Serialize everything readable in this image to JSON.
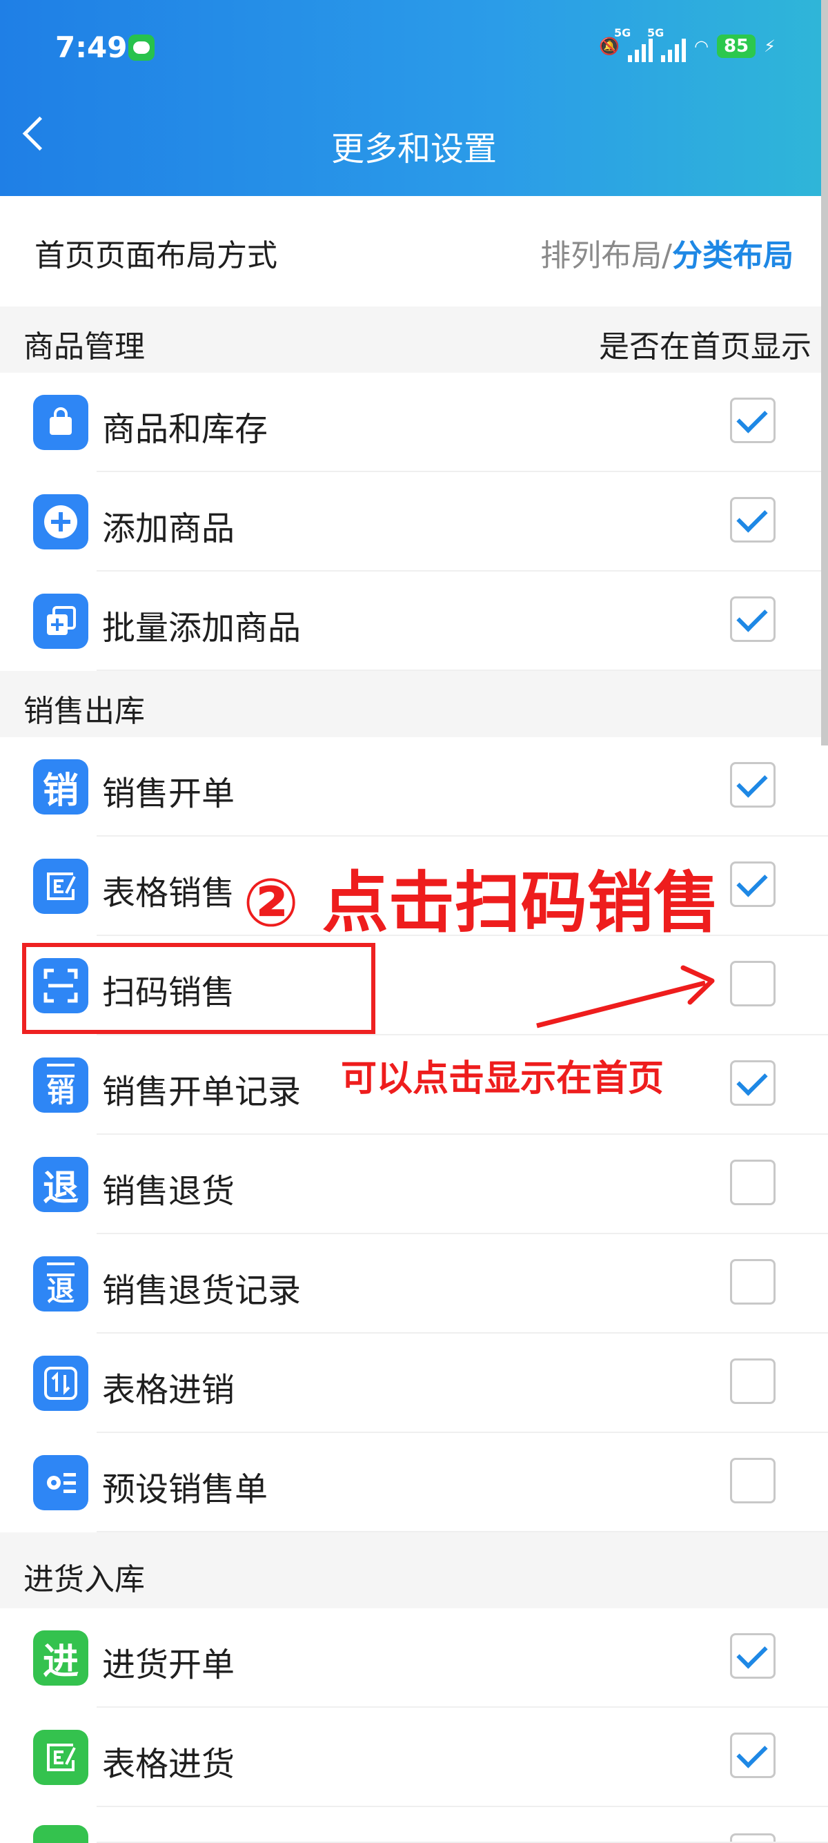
{
  "status_bar": {
    "time": "7:49",
    "network1": "5G",
    "network2": "5G",
    "battery": "85"
  },
  "header": {
    "title": "更多和设置"
  },
  "layout": {
    "label": "首页页面布局方式",
    "option_a": "排列布局",
    "separator": "/",
    "option_b": "分类布局"
  },
  "sections": [
    {
      "title": "商品管理",
      "right": "是否在首页显示",
      "items": [
        {
          "label": "商品和库存",
          "icon": "shopping-bag-icon",
          "checked": true
        },
        {
          "label": "添加商品",
          "icon": "plus-circle-icon",
          "checked": true
        },
        {
          "label": "批量添加商品",
          "icon": "batch-add-icon",
          "checked": true
        }
      ]
    },
    {
      "title": "销售出库",
      "items": [
        {
          "label": "销售开单",
          "icon_text": "销",
          "checked": true
        },
        {
          "label": "表格销售",
          "icon": "table-edit-icon",
          "checked": true
        },
        {
          "label": "扫码销售",
          "icon": "scan-icon",
          "checked": false
        },
        {
          "label": "销售开单记录",
          "icon_text": "销",
          "checked": true
        },
        {
          "label": "销售退货",
          "icon_text": "退",
          "checked": false
        },
        {
          "label": "销售退货记录",
          "icon_text": "退",
          "checked": false
        },
        {
          "label": "表格进销",
          "icon": "exchange-icon",
          "checked": false
        },
        {
          "label": "预设销售单",
          "icon": "preset-list-icon",
          "checked": false
        }
      ]
    },
    {
      "title": "进货入库",
      "items": [
        {
          "label": "进货开单",
          "icon_text": "进",
          "checked": true
        },
        {
          "label": "表格进货",
          "icon": "table-edit-icon",
          "checked": true
        }
      ]
    }
  ],
  "annotations": {
    "step": "② 点击扫码销售",
    "hint": "可以点击显示在首页"
  },
  "colors": {
    "accent": "#1e88e5",
    "header_start": "#1f7fe6",
    "annotation": "#ee1d1d",
    "green_icon": "#34c24e"
  }
}
